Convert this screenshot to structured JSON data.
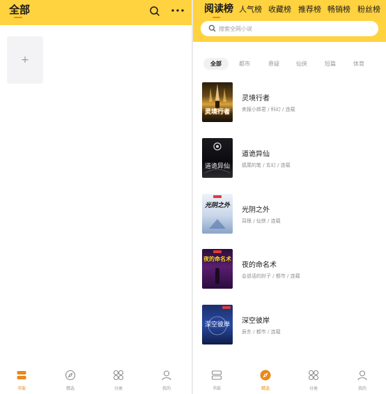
{
  "bookshelf_screen": {
    "header": {
      "title": "全部",
      "search_icon": "search-icon",
      "more_icon": "more-dots-icon"
    },
    "add_book_symbol": "+",
    "nav": [
      {
        "label": "书架",
        "icon": "bookshelf-icon",
        "active": true
      },
      {
        "label": "精选",
        "icon": "compass-icon",
        "active": false
      },
      {
        "label": "分类",
        "icon": "category-grid-icon",
        "active": false
      },
      {
        "label": "我的",
        "icon": "profile-icon",
        "active": false
      }
    ]
  },
  "ranking_screen": {
    "tabs": [
      {
        "label": "阅读榜",
        "active": true
      },
      {
        "label": "人气榜",
        "active": false
      },
      {
        "label": "收藏榜",
        "active": false
      },
      {
        "label": "推荐榜",
        "active": false
      },
      {
        "label": "畅销榜",
        "active": false
      },
      {
        "label": "粉丝榜",
        "active": false
      }
    ],
    "search": {
      "placeholder": "搜索全网小说",
      "value": ""
    },
    "categories": [
      {
        "label": "全部",
        "active": true
      },
      {
        "label": "都市",
        "active": false
      },
      {
        "label": "悬疑",
        "active": false
      },
      {
        "label": "仙侠",
        "active": false
      },
      {
        "label": "短篇",
        "active": false
      },
      {
        "label": "体育",
        "active": false
      }
    ],
    "books": [
      {
        "title": "灵境行者",
        "meta": "卖报小郎君 / 科幻 / 连载",
        "cover_title": "灵境行者"
      },
      {
        "title": "道诡异仙",
        "meta": "狐尾的笔 / 玄幻 / 连载",
        "cover_title": "道诡异仙"
      },
      {
        "title": "光阴之外",
        "meta": "耳根 / 仙侠 / 连载",
        "cover_title": "光阴之外"
      },
      {
        "title": "夜的命名术",
        "meta": "会说话的肘子 / 都市 / 连载",
        "cover_title": "夜的命名术"
      },
      {
        "title": "深空彼岸",
        "meta": "辰东 / 都市 / 连载",
        "cover_title": "深空彼岸"
      }
    ],
    "nav": [
      {
        "label": "书架",
        "icon": "bookshelf-icon",
        "active": false
      },
      {
        "label": "精选",
        "icon": "compass-icon",
        "active": true
      },
      {
        "label": "分类",
        "icon": "category-grid-icon",
        "active": false
      },
      {
        "label": "我的",
        "icon": "profile-icon",
        "active": false
      }
    ]
  },
  "colors": {
    "brand_yellow": "#ffd23f",
    "accent_orange": "#e8891b",
    "text_dark": "#1a1a1a",
    "text_gray": "#8e8e8e"
  }
}
